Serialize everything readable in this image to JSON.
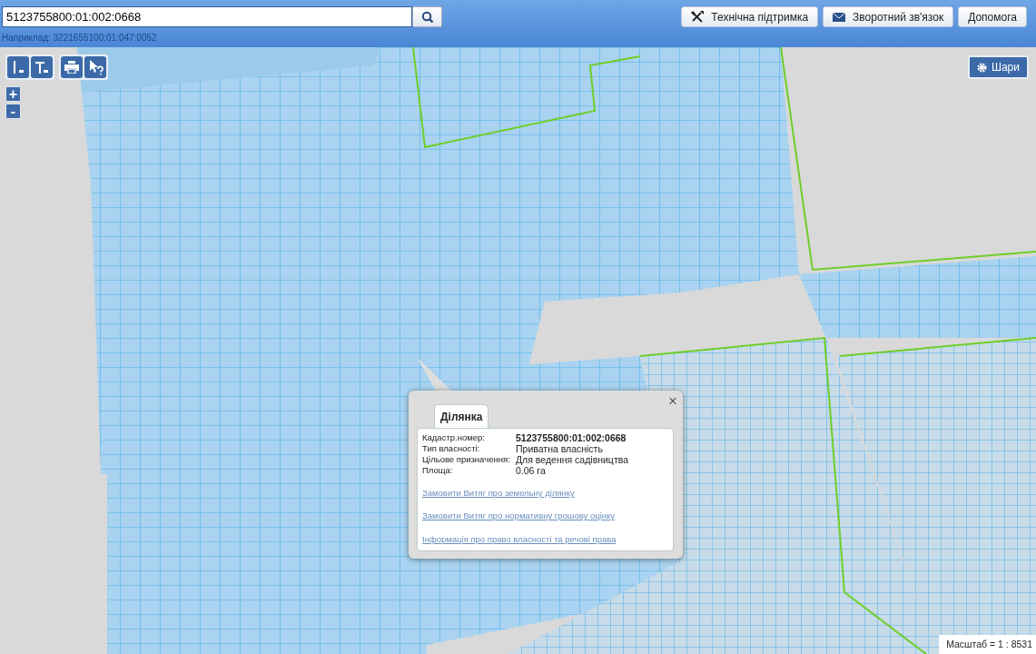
{
  "search": {
    "value": "5123755800:01:002:0668",
    "hint": "Наприклад: 3221655100:01:047:0052"
  },
  "header_buttons": [
    {
      "label": "Технічна підтримка",
      "kind": "tools"
    },
    {
      "label": "Зворотний зв'язок",
      "kind": "mail"
    },
    {
      "label": "Допомога",
      "kind": "plain"
    }
  ],
  "zoom": [
    "+",
    "-"
  ],
  "layers_button": "Шари",
  "popup": {
    "close": "×",
    "tab": "Ділянка",
    "fields": [
      {
        "label": "Кадастр.номер:",
        "value": "5123755800:01:002:0668",
        "bold": true
      },
      {
        "label": "Тип власності:",
        "value": "Приватна власність",
        "bold": false
      },
      {
        "label": "Цільове призначення:",
        "value": "Для ведення садівництва",
        "bold": false
      },
      {
        "label": "Площа:",
        "value": "0.06 га",
        "bold": false
      }
    ],
    "links": [
      "Замовити Витяг про земельну ділянку",
      "Замовити Витяг про нормативну грошову оцінку",
      "Інформація про право власності та речові права"
    ]
  },
  "scale": "Масштаб = 1 : 8531"
}
